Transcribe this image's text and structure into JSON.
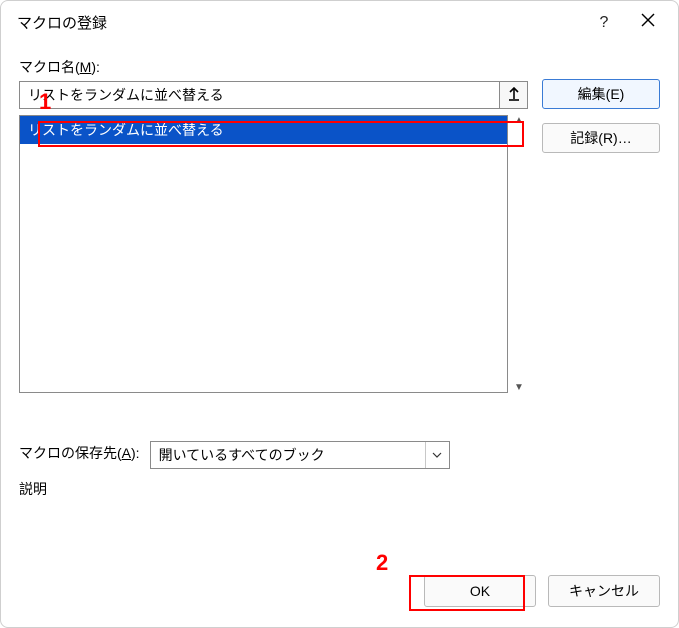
{
  "window": {
    "title": "マクロの登録"
  },
  "labels": {
    "macro_name_prefix": "マクロ名(",
    "macro_name_accel": "M",
    "macro_name_suffix": "):",
    "macro_location_prefix": "マクロの保存先(",
    "macro_location_accel": "A",
    "macro_location_suffix": "):",
    "description": "説明"
  },
  "macro_name": {
    "value": "リストをランダムに並べ替える"
  },
  "macro_list": [
    {
      "label": "リストをランダムに並べ替える",
      "selected": true
    }
  ],
  "macro_location": {
    "value": "開いているすべてのブック"
  },
  "buttons": {
    "edit": "編集(E)",
    "record": "記録(R)…",
    "ok": "OK",
    "cancel": "キャンセル"
  },
  "annotations": {
    "one": "1",
    "two": "2"
  }
}
